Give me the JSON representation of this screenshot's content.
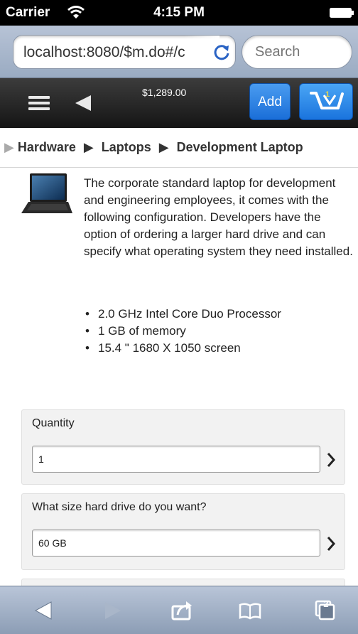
{
  "status_bar": {
    "carrier": "Carrier",
    "time": "4:15 PM"
  },
  "browser": {
    "url": "localhost:8080/$m.do#/c",
    "search_placeholder": "Search",
    "bottom_toolbar_icons": [
      "back-arrow-icon",
      "forward-arrow-icon",
      "share-icon",
      "bookmarks-icon",
      "tabs-icon"
    ],
    "tab_count": "2"
  },
  "app_toolbar": {
    "price": "$1,289.00",
    "add_label": "Add",
    "cart_count": "1",
    "colors": {
      "accent": "#1a74dd",
      "toolbar": "#151515"
    }
  },
  "breadcrumb": {
    "items": [
      "Hardware",
      "Laptops",
      "Development Laptop"
    ]
  },
  "product": {
    "description": "The corporate standard laptop for development and engineering employees, it comes with the following configuration. Developers have the option of ordering a larger hard drive and can specify what operating system they need installed.",
    "features": [
      "2.0 GHz Intel Core Duo Processor",
      "1 GB of memory",
      "15.4 \" 1680 X 1050 screen"
    ]
  },
  "form": {
    "quantity": {
      "label": "Quantity",
      "value": "1"
    },
    "hard_drive": {
      "label": "What size hard drive do you want?",
      "value": "60 GB"
    }
  }
}
